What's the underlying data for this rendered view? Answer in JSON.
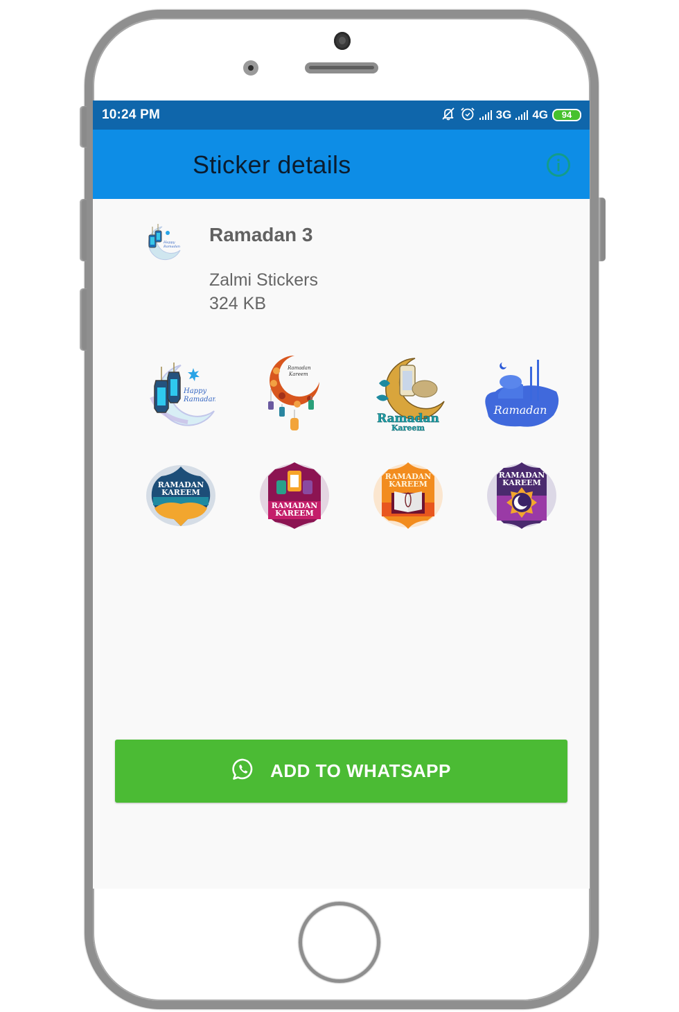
{
  "status_bar": {
    "time": "10:24 PM",
    "icons": [
      "notifications-off-icon",
      "alarm-icon",
      "signal-icon",
      "signal-icon"
    ],
    "network_1": "3G",
    "network_2": "4G",
    "battery": "94"
  },
  "app_bar": {
    "title": "Sticker details",
    "info_icon": "info-icon"
  },
  "pack": {
    "name": "Ramadan 3",
    "publisher": "Zalmi Stickers",
    "size": "324 KB",
    "tray_icon": "happy-ramadan-tray-icon"
  },
  "stickers": [
    {
      "name": "happy-ramadan-lanterns",
      "text": "Happy Ramadan"
    },
    {
      "name": "ramadan-kareem-crescent",
      "text": "Ramadan Kareem"
    },
    {
      "name": "ramadan-kareem-golden-crescent",
      "text": "Ramadan Kareem"
    },
    {
      "name": "ramadan-blue-mosque",
      "text": "Ramadan"
    },
    {
      "name": "ramadan-kareem-teal-badge",
      "text": "RAMADAN KAREEM"
    },
    {
      "name": "ramadan-kareem-magenta-badge",
      "text": "RAMADAN KAREEM"
    },
    {
      "name": "ramadan-kareem-orange-quran-badge",
      "text": "RAMADAN KAREEM"
    },
    {
      "name": "ramadan-kareem-purple-moon-badge",
      "text": "RAMADAN KAREEM"
    }
  ],
  "add_button": {
    "label": "ADD TO WHATSAPP",
    "icon": "whatsapp-icon"
  },
  "colors": {
    "status_bar": "#0f66ab",
    "app_bar": "#0d8de6",
    "button": "#4bbb34",
    "info_icon": "#139c8a"
  }
}
